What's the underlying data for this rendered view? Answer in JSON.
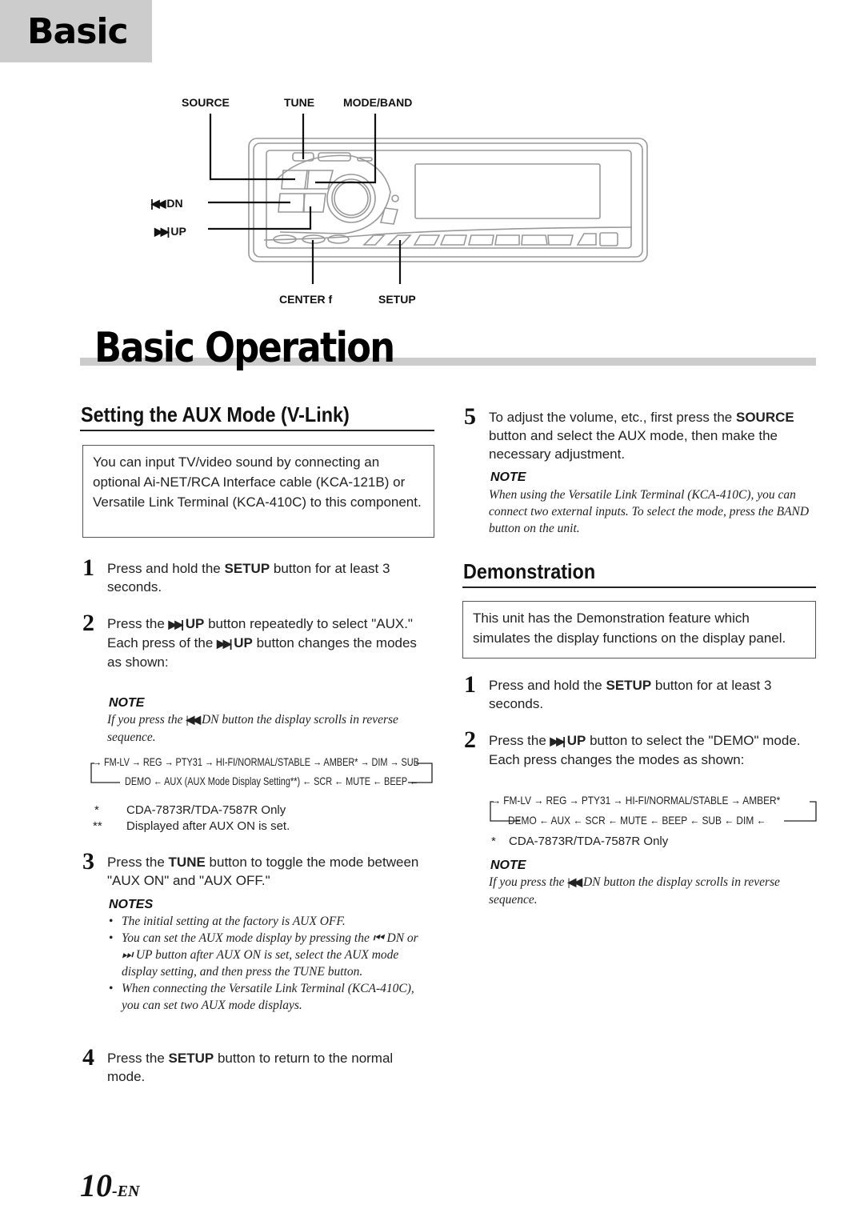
{
  "section_tab": "Basic",
  "diagram": {
    "labels": {
      "source": "SOURCE",
      "tune": "TUNE",
      "mode_band": "MODE/BAND",
      "dn": "DN",
      "up": "UP",
      "center": "CENTER f",
      "setup": "SETUP"
    },
    "icons": {
      "dn": "skip-back-icon",
      "up": "skip-forward-icon"
    }
  },
  "page_title": "Basic Operation",
  "left": {
    "heading": "Setting the AUX Mode (V-Link)",
    "intro_box": "You can input TV/video sound by connecting an optional Ai-NET/RCA Interface cable (KCA-121B) or Versatile Link Terminal (KCA-410C) to this component.",
    "step1": {
      "num": "1",
      "pre": "Press and hold the ",
      "bold": "SETUP",
      "post": " button for at least 3 seconds."
    },
    "step2": {
      "num": "2",
      "pre": "Press the ",
      "bold": "UP",
      "post": " button repeatedly to select \"AUX.\"",
      "line2_pre": "Each press of the ",
      "line2_bold": "UP",
      "line2_post": " button changes the modes as shown:",
      "note_heading": "NOTE",
      "note_pre": "If you press the ",
      "note_post": " DN button the display scrolls in reverse sequence.",
      "seq_top": "→ FM-LV → REG → PTY31 → HI-FI/NORMAL/STABLE → AMBER* → DIM → SUB",
      "seq_bottom": "DEMO ← AUX (AUX Mode Display Setting**) ← SCR ← MUTE ← BEEP ←",
      "footnote1_mark": "*",
      "footnote1": "CDA-7873R/TDA-7587R Only",
      "footnote2_mark": "**",
      "footnote2": "Displayed after AUX ON is set."
    },
    "step3": {
      "num": "3",
      "pre": "Press the ",
      "bold": "TUNE",
      "post": " button to toggle the mode between \"AUX ON\" and \"AUX OFF.\"",
      "notes_heading": "NOTES",
      "notes": [
        "The initial setting at the factory is AUX OFF.",
        "You can set the AUX mode display by pressing the ⏮ DN or ⏭ UP button after AUX ON is set, select the AUX mode display setting, and then press the TUNE button.",
        "When connecting the Versatile Link Terminal (KCA-410C), you can set two AUX mode displays."
      ]
    },
    "step4": {
      "num": "4",
      "pre": "Press the ",
      "bold": "SETUP",
      "post": " button to return to the normal mode."
    }
  },
  "right": {
    "step5": {
      "num": "5",
      "pre": "To adjust the volume, etc., first press the ",
      "bold": "SOURCE",
      "post": " button and select the AUX mode, then make the necessary adjustment.",
      "note_heading": "NOTE",
      "note": "When using the Versatile Link Terminal (KCA-410C), you can connect two external inputs. To select the mode, press the BAND button on the unit."
    },
    "heading": "Demonstration",
    "intro_box": "This unit has the Demonstration feature which simulates the display functions on the display panel.",
    "step1": {
      "num": "1",
      "pre": "Press and hold the ",
      "bold": "SETUP",
      "post": " button for at least 3 seconds."
    },
    "step2": {
      "num": "2",
      "pre": "Press the ",
      "bold": "UP",
      "post": " button to select the \"DEMO\" mode. Each press changes the modes as shown:",
      "seq_top": "→ FM-LV → REG → PTY31 → HI-FI/NORMAL/STABLE → AMBER*",
      "seq_bottom": "DEMO ← AUX ← SCR ← MUTE ← BEEP ← SUB ← DIM ←",
      "footnote1_mark": "*",
      "footnote1": "CDA-7873R/TDA-7587R Only",
      "note_heading": "NOTE",
      "note_pre": "If you press the ",
      "note_post": " DN button the display scrolls in reverse sequence."
    }
  },
  "page_number": "10",
  "page_suffix": "-EN"
}
